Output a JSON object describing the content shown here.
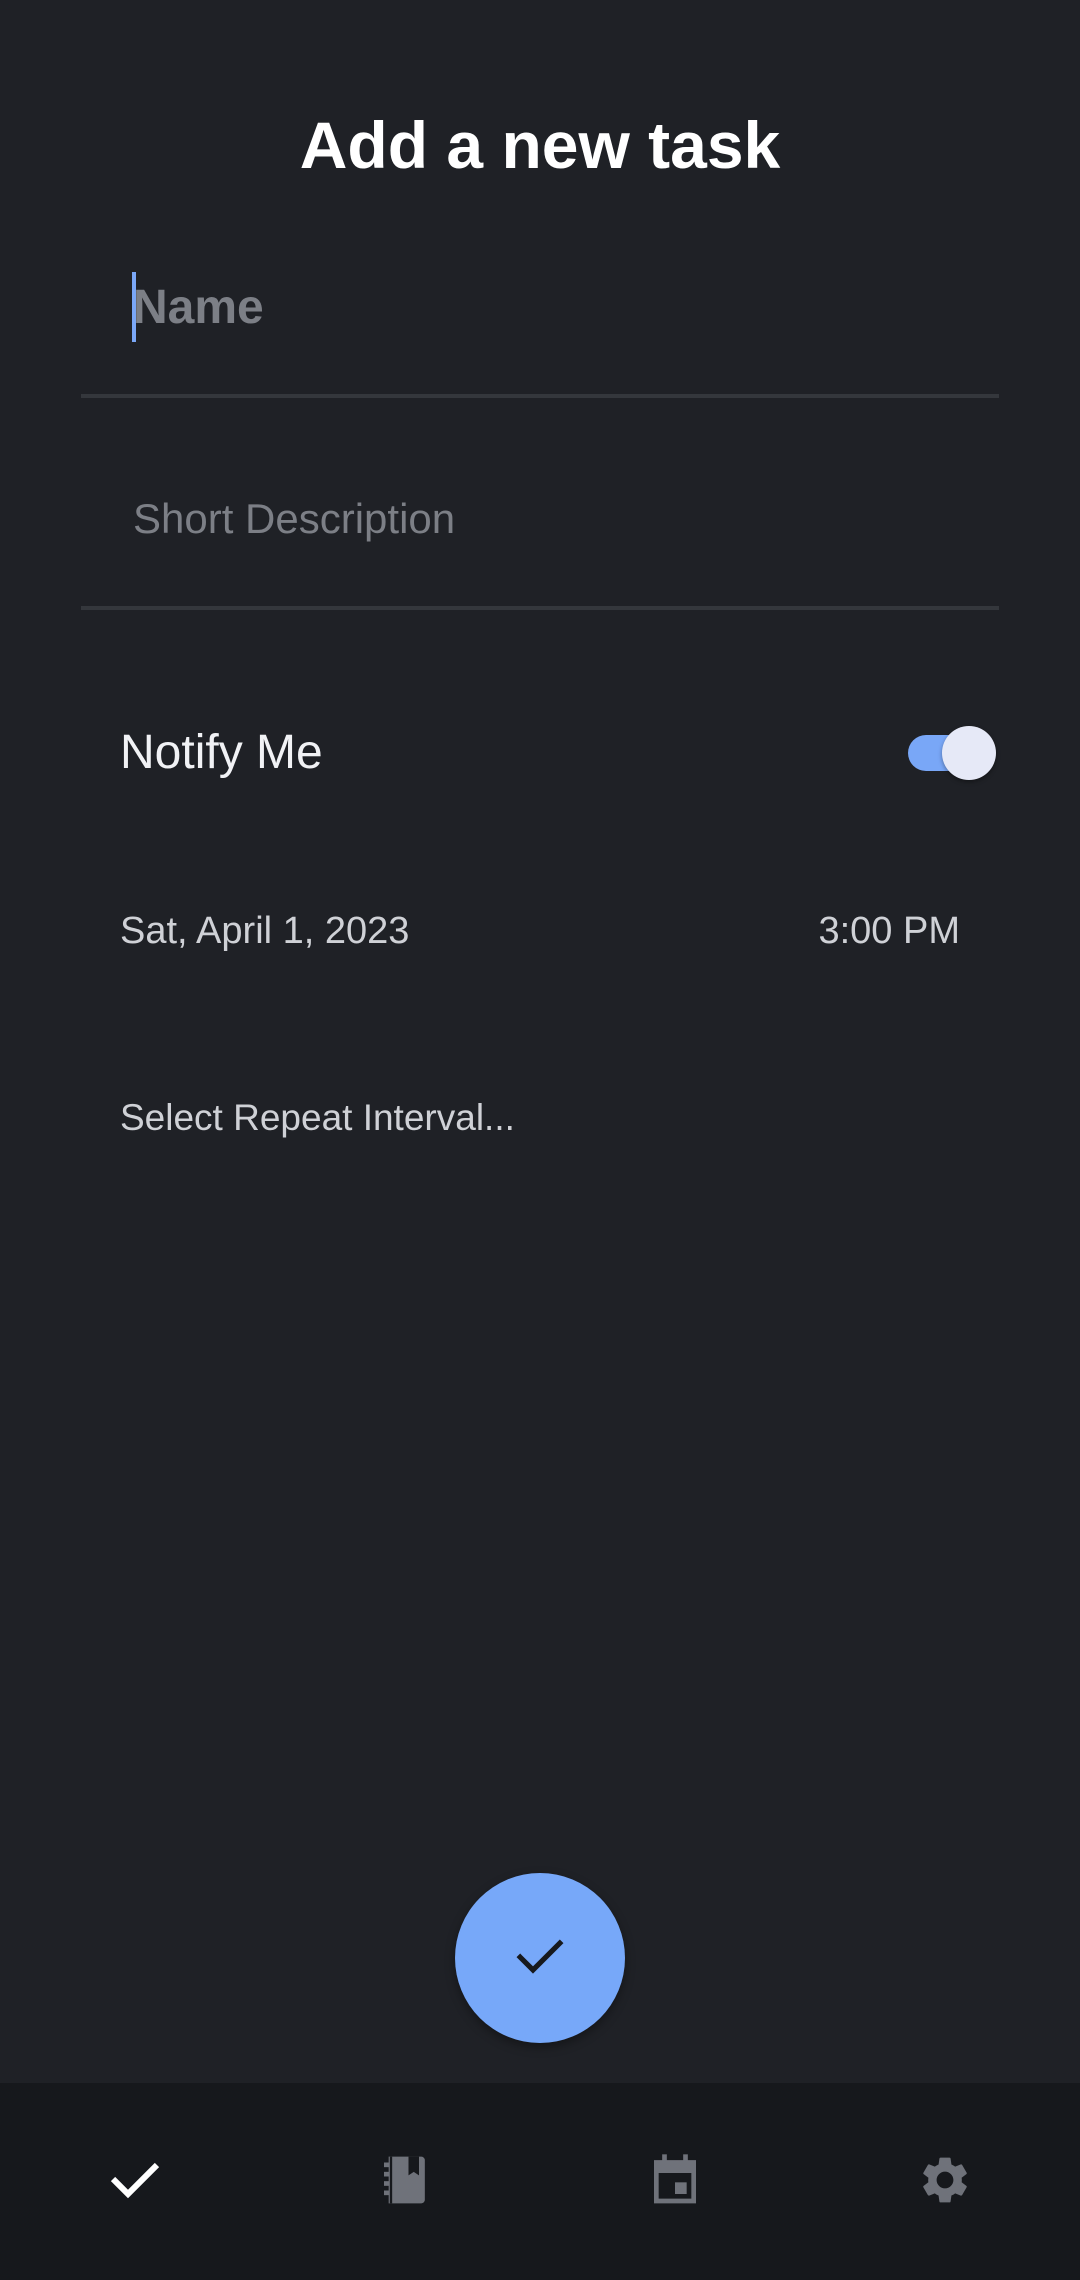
{
  "page": {
    "title": "Add a new task"
  },
  "form": {
    "name_placeholder": "Name",
    "name_value": "",
    "description_placeholder": "Short Description",
    "description_value": "",
    "notify_label": "Notify Me",
    "notify_enabled": true,
    "date": "Sat, April 1, 2023",
    "time": "3:00 PM",
    "repeat_placeholder": "Select Repeat Interval..."
  },
  "fab": {
    "icon": "check-icon"
  },
  "bottom_nav": {
    "items": [
      {
        "icon": "check-icon",
        "active": true
      },
      {
        "icon": "notebook-icon",
        "active": false
      },
      {
        "icon": "calendar-icon",
        "active": false
      },
      {
        "icon": "gear-icon",
        "active": false
      }
    ]
  },
  "colors": {
    "background": "#1f2126",
    "accent": "#77a8f9",
    "nav_background": "#16181c",
    "nav_icon_inactive": "#6f727a",
    "nav_icon_active": "#ffffff"
  }
}
